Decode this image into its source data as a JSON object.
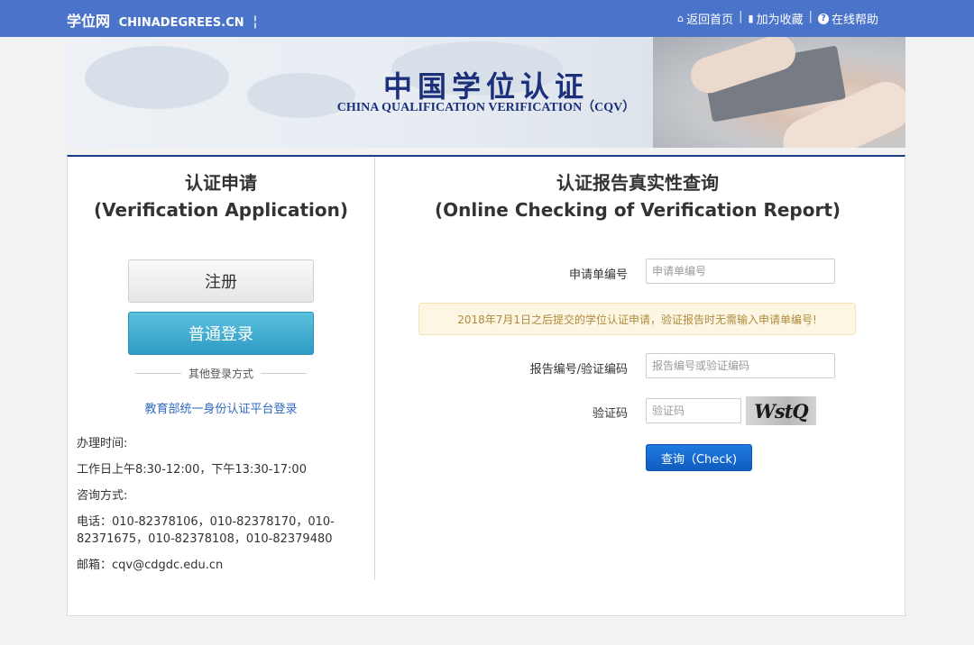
{
  "header": {
    "brand_cn": "学位网",
    "brand_en": "CHINADEGREES.CN",
    "brand_sep": "¦",
    "links": [
      {
        "icon": "home-icon",
        "glyph": "⌂",
        "label": "返回首页"
      },
      {
        "icon": "bookmark-icon",
        "glyph": "▮",
        "label": "加为收藏"
      },
      {
        "icon": "help-icon",
        "glyph": "?",
        "label": "在线帮助"
      }
    ],
    "divider": "|"
  },
  "banner": {
    "title_cn": "中国学位认证",
    "title_en": "CHINA QUALIFICATION VERIFICATION（CQV）"
  },
  "left": {
    "title_cn": "认证申请",
    "title_en": "(Verification Application)",
    "register_label": "注册",
    "login_label": "普通登录",
    "other_login": "其他登录方式",
    "edu_link": "教育部统一身份认证平台登录",
    "info": [
      "办理时间:",
      "工作日上午8:30-12:00，下午13:30-17:00",
      "咨询方式:",
      "电话：010-82378106，010-82378170，010-82371675，010-82378108，010-82379480",
      "邮箱：cqv@cdgdc.edu.cn"
    ]
  },
  "right": {
    "title_cn": "认证报告真实性查询",
    "title_en": "(Online Checking of Verification Report)",
    "application_no_label": "申请单编号",
    "application_no_placeholder": "申请单编号",
    "application_no_value": "",
    "notice": "2018年7月1日之后提交的学位认证申请，验证报告时无需输入申请单编号!",
    "report_no_label": "报告编号/验证编码",
    "report_no_placeholder": "报告编号或验证编码",
    "report_no_value": "",
    "captcha_label": "验证码",
    "captcha_placeholder": "验证码",
    "captcha_value": "",
    "captcha_text": "WstQ",
    "check_label": "查询（Check)"
  },
  "colors": {
    "topbar": "#4a74c9",
    "banner_title": "#1b2f7a",
    "panel_border_top": "#1c3c83",
    "login_button": "#2e9cc4",
    "check_button": "#0f5cc0",
    "link": "#2f6ac2",
    "notice_text": "#b08a3e"
  }
}
